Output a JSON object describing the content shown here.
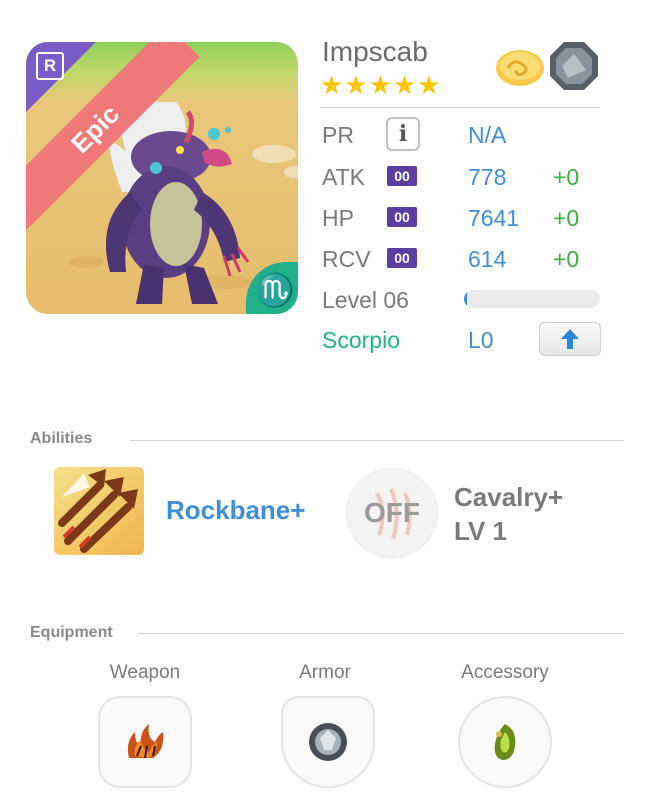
{
  "monster": {
    "rarity": "Epic",
    "corner_badge": "R",
    "name": "Impscab",
    "stars": "★★★★★",
    "zodiac_symbol": "♏",
    "element_icons": [
      "cloud-element-icon",
      "rock-element-icon"
    ]
  },
  "stats": {
    "pr": {
      "label": "PR",
      "info": "i",
      "value": "N/A"
    },
    "atk": {
      "label": "ATK",
      "badge": "00",
      "value": "778",
      "bonus": "+0"
    },
    "hp": {
      "label": "HP",
      "badge": "00",
      "value": "7641",
      "bonus": "+0"
    },
    "rcv": {
      "label": "RCV",
      "badge": "00",
      "value": "614",
      "bonus": "+0"
    },
    "level": {
      "label": "Level 06",
      "progress": 0.02
    },
    "zodiac": {
      "label": "Scorpio",
      "value": "L0"
    }
  },
  "abilities": {
    "title": "Abilities",
    "primary": {
      "name": "Rockbane+"
    },
    "secondary": {
      "state": "OFF",
      "name_line1": "Cavalry+",
      "name_line2": "LV 1"
    }
  },
  "equipment": {
    "title": "Equipment",
    "weapon": "Weapon",
    "armor": "Armor",
    "accessory": "Accessory"
  },
  "colors": {
    "accent_blue": "#3f8fd6",
    "bonus_green": "#3fad42",
    "epic_ribbon": "#f07878",
    "zodiac_teal": "#22b08a",
    "star_gold": "#f7c600"
  }
}
